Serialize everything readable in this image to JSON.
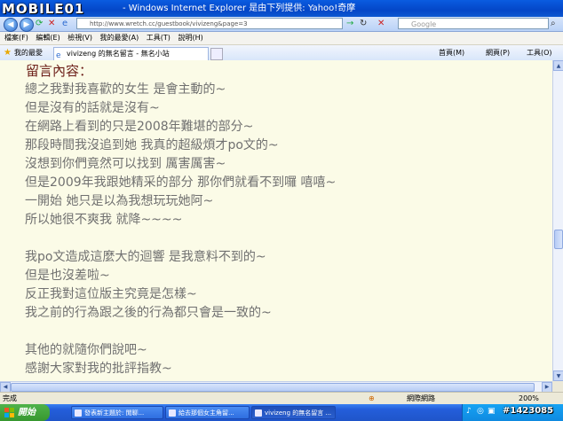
{
  "watermark": {
    "logo": "MOBILE01",
    "id": "#1423085"
  },
  "window": {
    "title": "- Windows Internet Explorer 是由下列提供: Yahoo!奇摩"
  },
  "toolbar": {
    "address": "http://www.wretch.cc/guestbook/vivizeng&page=3",
    "search_placeholder": "Google"
  },
  "menu": [
    "檔案(F)",
    "編輯(E)",
    "檢視(V)",
    "我的最愛(A)",
    "工具(T)",
    "說明(H)"
  ],
  "tabs": {
    "favorites_label": "我的最愛",
    "active_tab": "vivizeng 的無名留言 - 無名小站",
    "home_label": "首頁(M)",
    "page_label": "網頁(P)",
    "tools_label": "工具(O)"
  },
  "content": {
    "heading": "留言內容：",
    "lines": [
      "總之我對我喜歡的女生 是會主動的~",
      "但是沒有的話就是沒有~",
      "在網路上看到的只是2008年難堪的部分~",
      "那段時間我沒追到她 我真的超級煩才po文的~",
      "沒想到你們竟然可以找到 厲害厲害~",
      "但是2009年我跟她精采的部分 那你們就看不到囉 嘻嘻~",
      "一開始 她只是以為我想玩玩她阿~",
      "所以她很不爽我 就降~~~~",
      "",
      "我po文造成這麼大的迴響 是我意料不到的~",
      "但是也沒差啦~",
      "反正我對這位版主究竟是怎樣~",
      "我之前的行為跟之後的行為都只會是一致的~",
      "",
      "其他的就隨你們說吧~",
      "感謝大家對我的批評指教~"
    ]
  },
  "status": {
    "text": "完成",
    "zone": "網際網路",
    "zoom": "200%"
  },
  "taskbar": {
    "start_label": "開始",
    "tasks": [
      {
        "label": "發表新主題於: 閒聊..."
      },
      {
        "label": "給去那個女主角留..."
      },
      {
        "label": "vivizeng 的無名留言 ..."
      }
    ]
  },
  "colors": {
    "content_bg": "#fbfbe7",
    "heading": "#6b1d17",
    "body_text": "#707070"
  }
}
